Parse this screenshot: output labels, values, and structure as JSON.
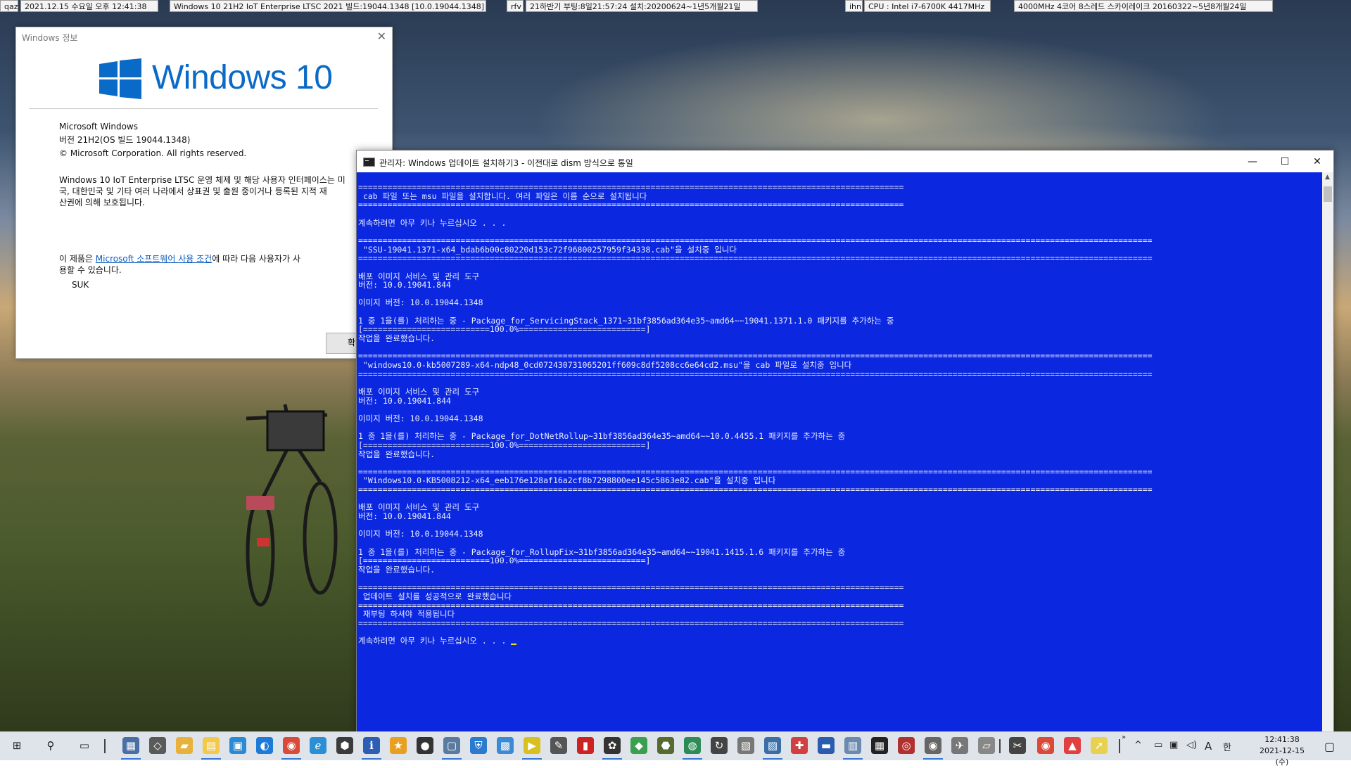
{
  "topbar": {
    "items": [
      "qaz",
      "2021.12.15 수요일 오후 12:41:38",
      "Windows 10 21H2 IoT Enterprise LTSC 2021 빌드:19044.1348 [10.0.19044.1348]",
      "rfv",
      "21하반기 부팅:8일21:57:24 설치:20200624~1년5개월21일",
      "ihn",
      "CPU : Intel i7-6700K 4417MHz",
      "4000MHz 4코어 8스레드 스카이레이크 20160322~5년8개월24일"
    ]
  },
  "about": {
    "title": "Windows 정보",
    "logo_text": "Windows 10",
    "product": "Microsoft Windows",
    "version": "버전 21H2(OS 빌드 19044.1348)",
    "copyright": "© Microsoft Corporation. All rights reserved.",
    "desc1": "Windows 10 IoT Enterprise LTSC 운영 체제 및 해당 사용자 인터페이스는 미",
    "desc2": "국, 대한민국 및 기타 여러 나라에서 상표권 및 출원 중이거나 등록된 지적 재",
    "desc3": "산권에 의해 보호됩니다.",
    "license_prefix": "이 제품은 ",
    "license_link": "Microsoft 소프트웨어 사용 조건",
    "license_suffix": "에 따라 다음 사용자가 사",
    "license_line2": "용할 수 있습니다.",
    "user": "SUK",
    "ok_label": "확"
  },
  "cmd": {
    "title": "관리자:  Windows 업데이트 설치하기3 - 이전대로 dism 방식으로 통일",
    "minimize": "—",
    "maximize": "☐",
    "close": "✕",
    "lines": [
      "================================================================================================================",
      " cab 파일 또는 msu 파일을 설치합니다. 여러 파일은 이름 순으로 설치됩니다",
      "================================================================================================================",
      "",
      "계속하려면 아무 키나 누르십시오 . . .",
      "",
      "===================================================================================================================================================================",
      " \"SSU-19041.1371-x64_bdab6b00c80220d153c72f96800257959f34338.cab\"을 설치중 입니다",
      "===================================================================================================================================================================",
      "",
      "배포 이미지 서비스 및 관리 도구",
      "버전: 10.0.19041.844",
      "",
      "이미지 버전: 10.0.19044.1348",
      "",
      "1 중 1을(를) 처리하는 중 - Package_for_ServicingStack_1371~31bf3856ad364e35~amd64~~19041.1371.1.0 패키지를 추가하는 중",
      "[==========================100.0%==========================]",
      "작업을 완료했습니다.",
      "",
      "===================================================================================================================================================================",
      " \"windows10.0-kb5007289-x64-ndp48_0cd072430731065201ff609c8df5208cc6e64cd2.msu\"을 cab 파일로 설치중 입니다",
      "===================================================================================================================================================================",
      "",
      "배포 이미지 서비스 및 관리 도구",
      "버전: 10.0.19041.844",
      "",
      "이미지 버전: 10.0.19044.1348",
      "",
      "1 중 1을(를) 처리하는 중 - Package_for_DotNetRollup~31bf3856ad364e35~amd64~~10.0.4455.1 패키지를 추가하는 중",
      "[==========================100.0%==========================]",
      "작업을 완료했습니다.",
      "",
      "===================================================================================================================================================================",
      " \"Windows10.0-KB5008212-x64_eeb176e128af16a2cf8b7298800ee145c5863e82.cab\"을 설치중 입니다",
      "===================================================================================================================================================================",
      "",
      "배포 이미지 서비스 및 관리 도구",
      "버전: 10.0.19041.844",
      "",
      "이미지 버전: 10.0.19044.1348",
      "",
      "1 중 1을(를) 처리하는 중 - Package_for_RollupFix~31bf3856ad364e35~amd64~~19041.1415.1.6 패키지를 추가하는 중",
      "[==========================100.0%==========================]",
      "작업을 완료했습니다.",
      "",
      "================================================================================================================",
      " 업데이트 설치를 성공적으로 완료했습니다",
      "================================================================================================================",
      " 재부팅 하셔야 적용됩니다",
      "================================================================================================================",
      "",
      "계속하려면 아무 키나 누르십시오 . . . "
    ]
  },
  "taskbar": {
    "clock_time": "12:41:38",
    "clock_date": "2021-12-15 (수)",
    "ime_mode": "A",
    "ime_lang": "한",
    "tray_overflow": "^",
    "chevron": "»",
    "icons": [
      "start-icon",
      "search-icon",
      "task-view-icon",
      "app-icon-1",
      "app-icon-2",
      "file-explorer-icon",
      "notes-icon",
      "app-icon-3",
      "edge-icon",
      "chrome-icon",
      "ie-icon",
      "app-icon-4",
      "info-icon",
      "app-icon-5",
      "app-icon-6",
      "app-icon-7",
      "shield-icon",
      "app-icon-8",
      "player-icon",
      "app-icon-9",
      "app-icon-10",
      "app-icon-11",
      "app-icon-12",
      "app-icon-13",
      "app-icon-14",
      "refresh-icon",
      "app-icon-15",
      "app-icon-16",
      "app-icon-17",
      "app-icon-18",
      "app-icon-19",
      "app-icon-20",
      "app-icon-21",
      "app-icon-22",
      "app-icon-23",
      "app-icon-24",
      "scissors-icon",
      "chrome-icon-2",
      "app-icon-25",
      "app-icon-26"
    ]
  }
}
